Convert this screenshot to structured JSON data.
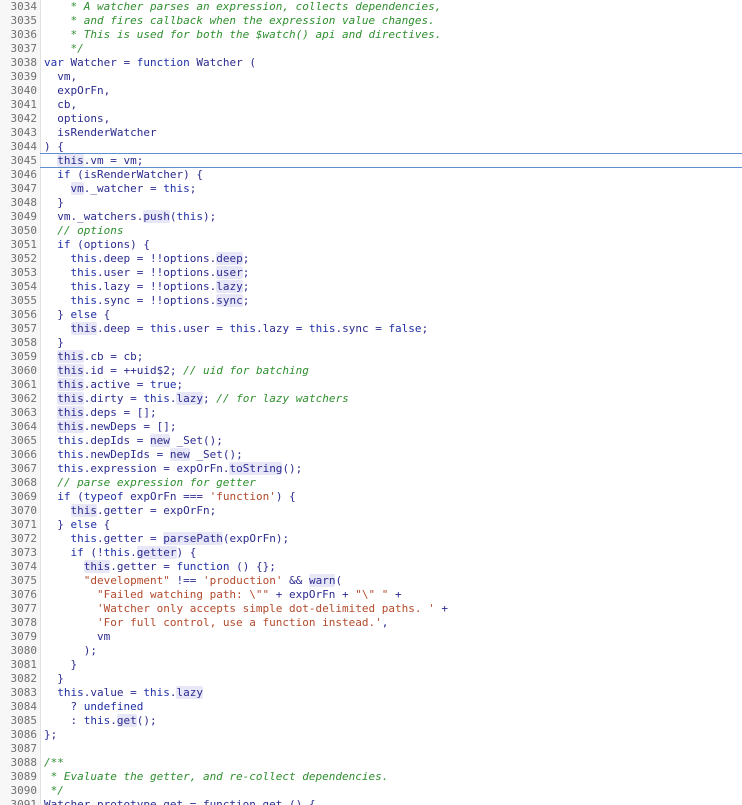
{
  "editor": {
    "lines": [
      {
        "n": "3034",
        "tokens": [
          {
            "t": "    * A watcher parses an expression, collects dependencies,",
            "c": "cm"
          }
        ]
      },
      {
        "n": "3035",
        "tokens": [
          {
            "t": "    * and fires callback when the expression value changes.",
            "c": "cm"
          }
        ]
      },
      {
        "n": "3036",
        "tokens": [
          {
            "t": "    * This is used for both the $watch() api and directives.",
            "c": "cm"
          }
        ]
      },
      {
        "n": "3037",
        "tokens": [
          {
            "t": "    */",
            "c": "cm"
          }
        ]
      },
      {
        "n": "3038",
        "tokens": [
          {
            "t": "var ",
            "c": "kw"
          },
          {
            "t": "Watcher",
            "c": "pl"
          },
          {
            "t": " = ",
            "c": "pl"
          },
          {
            "t": "function",
            "c": "kw"
          },
          {
            "t": " Watcher (",
            "c": "pl"
          }
        ]
      },
      {
        "n": "3039",
        "tokens": [
          {
            "t": "  vm,",
            "c": "pl"
          }
        ]
      },
      {
        "n": "3040",
        "tokens": [
          {
            "t": "  expOrFn,",
            "c": "pl"
          }
        ]
      },
      {
        "n": "3041",
        "tokens": [
          {
            "t": "  cb,",
            "c": "pl"
          }
        ]
      },
      {
        "n": "3042",
        "tokens": [
          {
            "t": "  options,",
            "c": "pl"
          }
        ]
      },
      {
        "n": "3043",
        "tokens": [
          {
            "t": "  isRenderWatcher",
            "c": "pl"
          }
        ]
      },
      {
        "n": "3044",
        "tokens": [
          {
            "t": ") {",
            "c": "pl"
          }
        ]
      },
      {
        "n": "3045",
        "tokens": [
          {
            "t": "  ",
            "c": "pl"
          },
          {
            "t": "this",
            "c": "hl"
          },
          {
            "t": ".vm = vm;",
            "c": "pl"
          }
        ]
      },
      {
        "n": "3046",
        "tokens": [
          {
            "t": "  ",
            "c": "pl"
          },
          {
            "t": "if",
            "c": "kw"
          },
          {
            "t": " (isRenderWatcher) {",
            "c": "pl"
          }
        ]
      },
      {
        "n": "3047",
        "tokens": [
          {
            "t": "    ",
            "c": "pl"
          },
          {
            "t": "vm",
            "c": "hl"
          },
          {
            "t": "._watcher = ",
            "c": "pl"
          },
          {
            "t": "this",
            "c": "kw"
          },
          {
            "t": ";",
            "c": "pl"
          }
        ]
      },
      {
        "n": "3048",
        "tokens": [
          {
            "t": "  }",
            "c": "pl"
          }
        ]
      },
      {
        "n": "3049",
        "tokens": [
          {
            "t": "  vm._watchers.",
            "c": "pl"
          },
          {
            "t": "push",
            "c": "hl"
          },
          {
            "t": "(",
            "c": "pl"
          },
          {
            "t": "this",
            "c": "kw"
          },
          {
            "t": ");",
            "c": "pl"
          }
        ]
      },
      {
        "n": "3050",
        "tokens": [
          {
            "t": "  // options",
            "c": "cm"
          }
        ]
      },
      {
        "n": "3051",
        "tokens": [
          {
            "t": "  ",
            "c": "pl"
          },
          {
            "t": "if",
            "c": "kw"
          },
          {
            "t": " (options) {",
            "c": "pl"
          }
        ]
      },
      {
        "n": "3052",
        "tokens": [
          {
            "t": "    ",
            "c": "pl"
          },
          {
            "t": "this",
            "c": "kw"
          },
          {
            "t": ".deep = !!options.",
            "c": "pl"
          },
          {
            "t": "deep",
            "c": "hl"
          },
          {
            "t": ";",
            "c": "pl"
          }
        ]
      },
      {
        "n": "3053",
        "tokens": [
          {
            "t": "    ",
            "c": "pl"
          },
          {
            "t": "this",
            "c": "kw"
          },
          {
            "t": ".user = !!options.",
            "c": "pl"
          },
          {
            "t": "user",
            "c": "hl"
          },
          {
            "t": ";",
            "c": "pl"
          }
        ]
      },
      {
        "n": "3054",
        "tokens": [
          {
            "t": "    ",
            "c": "pl"
          },
          {
            "t": "this",
            "c": "kw"
          },
          {
            "t": ".lazy = !!options.",
            "c": "pl"
          },
          {
            "t": "lazy",
            "c": "hl"
          },
          {
            "t": ";",
            "c": "pl"
          }
        ]
      },
      {
        "n": "3055",
        "tokens": [
          {
            "t": "    ",
            "c": "pl"
          },
          {
            "t": "this",
            "c": "kw"
          },
          {
            "t": ".sync = !!options.",
            "c": "pl"
          },
          {
            "t": "sync",
            "c": "hl"
          },
          {
            "t": ";",
            "c": "pl"
          }
        ]
      },
      {
        "n": "3056",
        "tokens": [
          {
            "t": "  } ",
            "c": "pl"
          },
          {
            "t": "else",
            "c": "kw"
          },
          {
            "t": " {",
            "c": "pl"
          }
        ]
      },
      {
        "n": "3057",
        "tokens": [
          {
            "t": "    ",
            "c": "pl"
          },
          {
            "t": "this",
            "c": "hl"
          },
          {
            "t": ".deep = ",
            "c": "pl"
          },
          {
            "t": "this",
            "c": "kw"
          },
          {
            "t": ".user = ",
            "c": "pl"
          },
          {
            "t": "this",
            "c": "kw"
          },
          {
            "t": ".lazy = ",
            "c": "pl"
          },
          {
            "t": "this",
            "c": "kw"
          },
          {
            "t": ".sync = ",
            "c": "pl"
          },
          {
            "t": "false",
            "c": "kw"
          },
          {
            "t": ";",
            "c": "pl"
          }
        ]
      },
      {
        "n": "3058",
        "tokens": [
          {
            "t": "  }",
            "c": "pl"
          }
        ]
      },
      {
        "n": "3059",
        "tokens": [
          {
            "t": "  ",
            "c": "pl"
          },
          {
            "t": "this",
            "c": "hl"
          },
          {
            "t": ".cb = cb;",
            "c": "pl"
          }
        ]
      },
      {
        "n": "3060",
        "tokens": [
          {
            "t": "  ",
            "c": "pl"
          },
          {
            "t": "this",
            "c": "hl"
          },
          {
            "t": ".id = ++uid$2; ",
            "c": "pl"
          },
          {
            "t": "// uid for batching",
            "c": "cm"
          }
        ]
      },
      {
        "n": "3061",
        "tokens": [
          {
            "t": "  ",
            "c": "pl"
          },
          {
            "t": "this",
            "c": "hl"
          },
          {
            "t": ".active = ",
            "c": "pl"
          },
          {
            "t": "true",
            "c": "kw"
          },
          {
            "t": ";",
            "c": "pl"
          }
        ]
      },
      {
        "n": "3062",
        "tokens": [
          {
            "t": "  ",
            "c": "pl"
          },
          {
            "t": "this",
            "c": "hl"
          },
          {
            "t": ".dirty = ",
            "c": "pl"
          },
          {
            "t": "this",
            "c": "kw"
          },
          {
            "t": ".",
            "c": "pl"
          },
          {
            "t": "lazy",
            "c": "hl"
          },
          {
            "t": "; ",
            "c": "pl"
          },
          {
            "t": "// for lazy watchers",
            "c": "cm"
          }
        ]
      },
      {
        "n": "3063",
        "tokens": [
          {
            "t": "  ",
            "c": "pl"
          },
          {
            "t": "this",
            "c": "hl"
          },
          {
            "t": ".deps = [];",
            "c": "pl"
          }
        ]
      },
      {
        "n": "3064",
        "tokens": [
          {
            "t": "  ",
            "c": "pl"
          },
          {
            "t": "this",
            "c": "hl"
          },
          {
            "t": ".newDeps = [];",
            "c": "pl"
          }
        ]
      },
      {
        "n": "3065",
        "tokens": [
          {
            "t": "  ",
            "c": "pl"
          },
          {
            "t": "this",
            "c": "kw"
          },
          {
            "t": ".depIds = ",
            "c": "pl"
          },
          {
            "t": "new",
            "c": "hl"
          },
          {
            "t": " _Set();",
            "c": "pl"
          }
        ]
      },
      {
        "n": "3066",
        "tokens": [
          {
            "t": "  ",
            "c": "pl"
          },
          {
            "t": "this",
            "c": "kw"
          },
          {
            "t": ".newDepIds = ",
            "c": "pl"
          },
          {
            "t": "new",
            "c": "hl"
          },
          {
            "t": " _Set();",
            "c": "pl"
          }
        ]
      },
      {
        "n": "3067",
        "tokens": [
          {
            "t": "  ",
            "c": "pl"
          },
          {
            "t": "this",
            "c": "kw"
          },
          {
            "t": ".expression = expOrFn.",
            "c": "pl"
          },
          {
            "t": "toString",
            "c": "hl"
          },
          {
            "t": "();",
            "c": "pl"
          }
        ]
      },
      {
        "n": "3068",
        "tokens": [
          {
            "t": "  // parse expression for getter",
            "c": "cm"
          }
        ]
      },
      {
        "n": "3069",
        "tokens": [
          {
            "t": "  ",
            "c": "pl"
          },
          {
            "t": "if",
            "c": "kw"
          },
          {
            "t": " (",
            "c": "pl"
          },
          {
            "t": "typeof",
            "c": "kw"
          },
          {
            "t": " expOrFn === ",
            "c": "pl"
          },
          {
            "t": "'function'",
            "c": "str"
          },
          {
            "t": ") {",
            "c": "pl"
          }
        ]
      },
      {
        "n": "3070",
        "tokens": [
          {
            "t": "    ",
            "c": "pl"
          },
          {
            "t": "this",
            "c": "hl"
          },
          {
            "t": ".getter = expOrFn;",
            "c": "pl"
          }
        ]
      },
      {
        "n": "3071",
        "tokens": [
          {
            "t": "  } ",
            "c": "pl"
          },
          {
            "t": "else",
            "c": "kw"
          },
          {
            "t": " {",
            "c": "pl"
          }
        ]
      },
      {
        "n": "3072",
        "tokens": [
          {
            "t": "    ",
            "c": "pl"
          },
          {
            "t": "this",
            "c": "kw"
          },
          {
            "t": ".getter = ",
            "c": "pl"
          },
          {
            "t": "parsePath",
            "c": "hl"
          },
          {
            "t": "(expOrFn);",
            "c": "pl"
          }
        ]
      },
      {
        "n": "3073",
        "tokens": [
          {
            "t": "    ",
            "c": "pl"
          },
          {
            "t": "if",
            "c": "kw"
          },
          {
            "t": " (!",
            "c": "pl"
          },
          {
            "t": "this",
            "c": "kw"
          },
          {
            "t": ".",
            "c": "pl"
          },
          {
            "t": "getter",
            "c": "hl"
          },
          {
            "t": ") {",
            "c": "pl"
          }
        ]
      },
      {
        "n": "3074",
        "tokens": [
          {
            "t": "      ",
            "c": "pl"
          },
          {
            "t": "this",
            "c": "hl"
          },
          {
            "t": ".getter = ",
            "c": "pl"
          },
          {
            "t": "function",
            "c": "kw"
          },
          {
            "t": " () {};",
            "c": "pl"
          }
        ]
      },
      {
        "n": "3075",
        "tokens": [
          {
            "t": "      ",
            "c": "pl"
          },
          {
            "t": "\"development\"",
            "c": "str"
          },
          {
            "t": " !== ",
            "c": "pl"
          },
          {
            "t": "'production'",
            "c": "str"
          },
          {
            "t": " && ",
            "c": "pl"
          },
          {
            "t": "warn",
            "c": "hl"
          },
          {
            "t": "(",
            "c": "pl"
          }
        ]
      },
      {
        "n": "3076",
        "tokens": [
          {
            "t": "        ",
            "c": "pl"
          },
          {
            "t": "\"Failed watching path: \\\"\"",
            "c": "str"
          },
          {
            "t": " + expOrFn + ",
            "c": "pl"
          },
          {
            "t": "\"\\\" \"",
            "c": "str"
          },
          {
            "t": " +",
            "c": "pl"
          }
        ]
      },
      {
        "n": "3077",
        "tokens": [
          {
            "t": "        ",
            "c": "pl"
          },
          {
            "t": "'Watcher only accepts simple dot-delimited paths. '",
            "c": "str"
          },
          {
            "t": " +",
            "c": "pl"
          }
        ]
      },
      {
        "n": "3078",
        "tokens": [
          {
            "t": "        ",
            "c": "pl"
          },
          {
            "t": "'For full control, use a function instead.'",
            "c": "str"
          },
          {
            "t": ",",
            "c": "pl"
          }
        ]
      },
      {
        "n": "3079",
        "tokens": [
          {
            "t": "        vm",
            "c": "pl"
          }
        ]
      },
      {
        "n": "3080",
        "tokens": [
          {
            "t": "      );",
            "c": "pl"
          }
        ]
      },
      {
        "n": "3081",
        "tokens": [
          {
            "t": "    }",
            "c": "pl"
          }
        ]
      },
      {
        "n": "3082",
        "tokens": [
          {
            "t": "  }",
            "c": "pl"
          }
        ]
      },
      {
        "n": "3083",
        "tokens": [
          {
            "t": "  ",
            "c": "pl"
          },
          {
            "t": "this",
            "c": "kw"
          },
          {
            "t": ".value = ",
            "c": "pl"
          },
          {
            "t": "this",
            "c": "kw"
          },
          {
            "t": ".",
            "c": "pl"
          },
          {
            "t": "lazy",
            "c": "hl"
          }
        ]
      },
      {
        "n": "3084",
        "tokens": [
          {
            "t": "    ? ",
            "c": "pl"
          },
          {
            "t": "undefined",
            "c": "kw"
          }
        ]
      },
      {
        "n": "3085",
        "tokens": [
          {
            "t": "    : ",
            "c": "pl"
          },
          {
            "t": "this",
            "c": "kw"
          },
          {
            "t": ".",
            "c": "pl"
          },
          {
            "t": "get",
            "c": "hl"
          },
          {
            "t": "();",
            "c": "pl"
          }
        ]
      },
      {
        "n": "3086",
        "tokens": [
          {
            "t": "};",
            "c": "pl"
          }
        ]
      },
      {
        "n": "3087",
        "tokens": [
          {
            "t": "",
            "c": "pl"
          }
        ]
      },
      {
        "n": "3088",
        "tokens": [
          {
            "t": "/**",
            "c": "cm"
          }
        ]
      },
      {
        "n": "3089",
        "tokens": [
          {
            "t": " * Evaluate the getter, and re-collect dependencies.",
            "c": "cm"
          }
        ]
      },
      {
        "n": "3090",
        "tokens": [
          {
            "t": " */",
            "c": "cm"
          }
        ]
      },
      {
        "n": "3091",
        "tokens": [
          {
            "t": "Watcher.prototype.get = function get () {",
            "c": "pl"
          }
        ]
      }
    ]
  }
}
